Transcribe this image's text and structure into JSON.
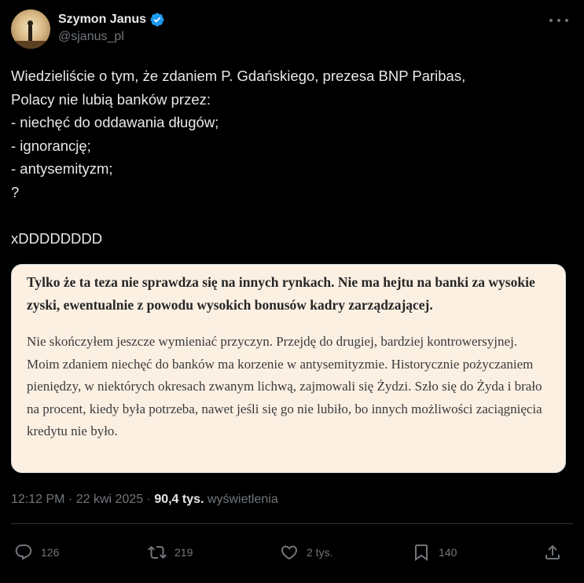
{
  "author": {
    "display_name": "Szymon Janus",
    "handle": "@sjanus_pl",
    "verified": true,
    "verified_color": "#1d9bf0"
  },
  "tweet": {
    "text": "Wiedzieliście o tym, że zdaniem P. Gdańskiego, prezesa BNP Paribas,\nPolacy nie lubią banków przez:\n- niechęć do oddawania długów;\n- ignorancję;\n- antysemityzm;\n?\n\nxDDDDDDDD"
  },
  "quote_image": {
    "lead": "Tylko że ta teza nie sprawdza się na innych rynkach. Nie ma hejtu na banki za wysokie zyski, ewentualnie z powodu wysokich bonusów kadry zarządzającej.",
    "body": "Nie skończyłem jeszcze wymieniać przyczyn. Przejdę do drugiej, bardziej kontrowersyjnej. Moim zdaniem niechęć do banków ma korzenie w antysemityzmie. Historycznie pożyczaniem pieniędzy, w niektórych okresach zwanym lichwą, zajmowali się Żydzi. Szło się do Żyda i brało na procent, kiedy była potrzeba, nawet jeśli się go nie lubiło, bo innych możliwości zaciągnięcia kredytu nie było."
  },
  "meta": {
    "time": "12:12 PM",
    "sep1": " · ",
    "date": "22 kwi 2025",
    "sep2": " · ",
    "views_count": "90,4 tys.",
    "views_label": " wyświetlenia"
  },
  "actions": {
    "reply": {
      "icon": "reply-icon",
      "count": "126"
    },
    "retweet": {
      "icon": "retweet-icon",
      "count": "219"
    },
    "like": {
      "icon": "heart-icon",
      "count": "2 tys."
    },
    "bookmark": {
      "icon": "bookmark-icon",
      "count": "140"
    },
    "share": {
      "icon": "share-icon"
    }
  },
  "colors": {
    "background": "#000000",
    "text": "#e7e9ea",
    "secondary_text": "#71767b",
    "quote_background": "#fcf0e3"
  }
}
